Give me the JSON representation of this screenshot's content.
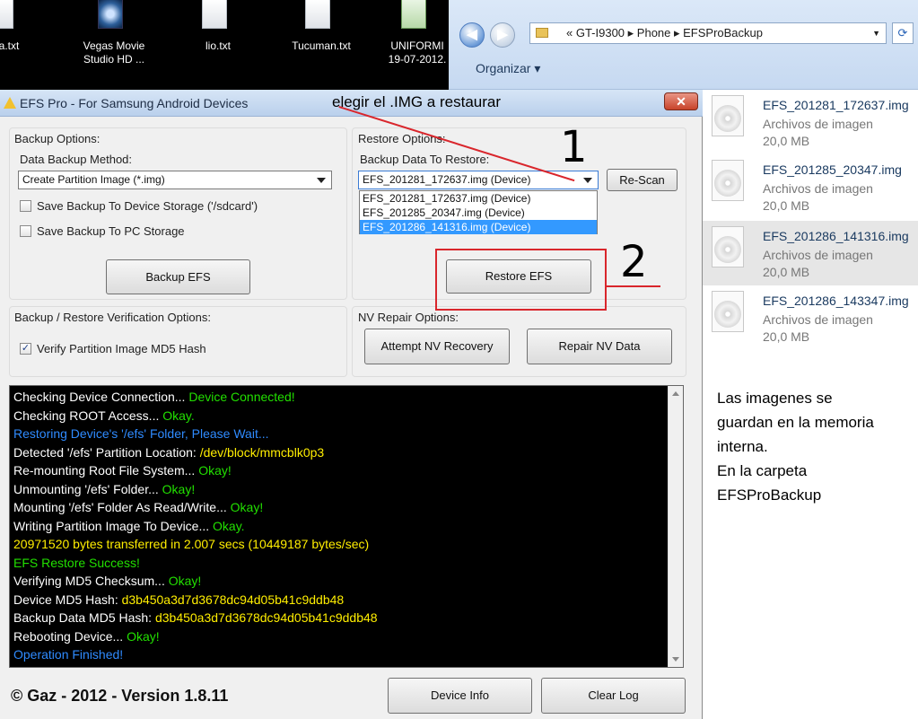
{
  "desktop": {
    "icons": [
      {
        "label": "ma.txt",
        "label2": ""
      },
      {
        "label": "Vegas Movie",
        "label2": "Studio HD ..."
      },
      {
        "label": "lio.txt",
        "label2": ""
      },
      {
        "label": "Tucuman.txt",
        "label2": ""
      },
      {
        "label": "UNIFORMI",
        "label2": "19-07-2012."
      }
    ]
  },
  "explorer": {
    "path": "« GT-I9300 ▸ Phone ▸ EFSProBackup",
    "organize": "Organizar ▾",
    "files": [
      {
        "name": "EFS_201281_172637.img",
        "type": "Archivos de imagen",
        "size": "20,0 MB"
      },
      {
        "name": "EFS_201285_20347.img",
        "type": "Archivos de imagen",
        "size": "20,0 MB"
      },
      {
        "name": "EFS_201286_141316.img",
        "type": "Archivos de imagen",
        "size": "20,0 MB"
      },
      {
        "name": "EFS_201286_143347.img",
        "type": "Archivos de imagen",
        "size": "20,0 MB"
      }
    ],
    "note_lines": [
      "Las imagenes se",
      "guardan en la memoria",
      "interna.",
      "En la carpeta",
      "EFSProBackup"
    ]
  },
  "app": {
    "title": "EFS Pro - For Samsung Android Devices",
    "annotation_title": "elegir el .IMG a restaurar",
    "close_label": "✕",
    "backup": {
      "group_label": "Backup Options:",
      "method_label": "Data Backup Method:",
      "method_value": "Create Partition Image (*.img)",
      "save_device": "Save Backup To Device Storage ('/sdcard')",
      "save_pc": "Save Backup To PC Storage",
      "backup_button": "Backup EFS"
    },
    "restore": {
      "group_label": "Restore Options:",
      "data_label": "Backup Data To Restore:",
      "selected": "EFS_201281_172637.img (Device)",
      "options": [
        "EFS_201281_172637.img (Device)",
        "EFS_201285_20347.img (Device)",
        "EFS_201286_141316.img (Device)"
      ],
      "rescan_button": "Re-Scan",
      "restore_button": "Restore EFS"
    },
    "verification": {
      "group_label": "Backup / Restore Verification Options:",
      "verify_md5": "Verify Partition Image MD5 Hash",
      "verify_checked": "✓"
    },
    "nv": {
      "group_label": "NV Repair Options:",
      "attempt_button": "Attempt NV Recovery",
      "repair_button": "Repair NV Data"
    },
    "log": [
      {
        "parts": [
          {
            "t": "Checking Device Connection...  ",
            "c": "#ffffff"
          },
          {
            "t": "Device Connected!",
            "c": "#22e000"
          }
        ]
      },
      {
        "parts": [
          {
            "t": "Checking ROOT Access...  ",
            "c": "#ffffff"
          },
          {
            "t": "Okay.",
            "c": "#22e000"
          }
        ]
      },
      {
        "parts": [
          {
            "t": "Restoring Device's '/efs' Folder, Please Wait...",
            "c": "#2f8bff"
          }
        ]
      },
      {
        "parts": [
          {
            "t": "Detected '/efs' Partition Location:  ",
            "c": "#ffffff"
          },
          {
            "t": "/dev/block/mmcblk0p3",
            "c": "#ffee00"
          }
        ]
      },
      {
        "parts": [
          {
            "t": "Re-mounting Root File System...  ",
            "c": "#ffffff"
          },
          {
            "t": "Okay!",
            "c": "#22e000"
          }
        ]
      },
      {
        "parts": [
          {
            "t": "Unmounting '/efs' Folder...  ",
            "c": "#ffffff"
          },
          {
            "t": "Okay!",
            "c": "#22e000"
          }
        ]
      },
      {
        "parts": [
          {
            "t": "Mounting '/efs' Folder As Read/Write...  ",
            "c": "#ffffff"
          },
          {
            "t": "Okay!",
            "c": "#22e000"
          }
        ]
      },
      {
        "parts": [
          {
            "t": "Writing Partition Image To Device...  ",
            "c": "#ffffff"
          },
          {
            "t": "Okay.",
            "c": "#22e000"
          }
        ]
      },
      {
        "parts": [
          {
            "t": "20971520 bytes transferred in 2.007 secs (10449187 bytes/sec)",
            "c": "#ffee00"
          }
        ]
      },
      {
        "parts": [
          {
            "t": "EFS Restore Success!",
            "c": "#22e000"
          }
        ]
      },
      {
        "parts": [
          {
            "t": "Verifying MD5 Checksum...  ",
            "c": "#ffffff"
          },
          {
            "t": "Okay!",
            "c": "#22e000"
          }
        ]
      },
      {
        "parts": [
          {
            "t": "Device MD5 Hash:  ",
            "c": "#ffffff"
          },
          {
            "t": "d3b450a3d7d3678dc94d05b41c9ddb48",
            "c": "#ffee00"
          }
        ]
      },
      {
        "parts": [
          {
            "t": "Backup Data MD5 Hash:  ",
            "c": "#ffffff"
          },
          {
            "t": "d3b450a3d7d3678dc94d05b41c9ddb48",
            "c": "#ffee00"
          }
        ]
      },
      {
        "parts": [
          {
            "t": "Rebooting Device...  ",
            "c": "#ffffff"
          },
          {
            "t": "Okay!",
            "c": "#22e000"
          }
        ]
      },
      {
        "parts": [
          {
            "t": "Operation Finished!",
            "c": "#2f8bff"
          }
        ]
      }
    ],
    "copyright": "© Gaz - 2012 - Version 1.8.11",
    "device_info_button": "Device Info",
    "clear_log_button": "Clear Log"
  },
  "annotations": {
    "step1": "1",
    "step2": "2",
    "color": "#d9262c"
  }
}
